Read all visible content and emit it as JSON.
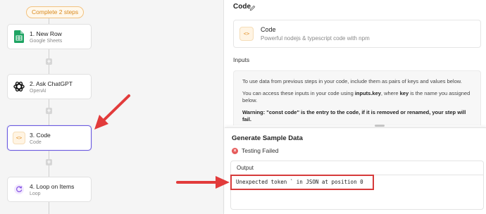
{
  "flow": {
    "progress_label": "Complete 2 steps",
    "steps": [
      {
        "title": "1. New Row",
        "subtitle": "Google Sheets"
      },
      {
        "title": "2. Ask ChatGPT",
        "subtitle": "OpenAI"
      },
      {
        "title": "3. Code",
        "subtitle": "Code"
      },
      {
        "title": "4. Loop on Items",
        "subtitle": "Loop"
      }
    ]
  },
  "panel": {
    "title": "Code",
    "piece": {
      "name": "Code",
      "description": "Powerful nodejs & typescript code with npm"
    },
    "inputs_label": "Inputs",
    "info": {
      "p1": "To use data from previous steps in your code, include them as pairs of keys and values below.",
      "p2_a": "You can access these inputs in your code using ",
      "p2_key": "inputs.key",
      "p2_b": ", where ",
      "p2_key2": "key",
      "p2_c": " is the name you assigned below.",
      "warning": "Warning: \"const code\" is the entry to the code, if it is removed or renamed, your step will fail."
    }
  },
  "sample": {
    "title": "Generate Sample Data",
    "status": "Testing Failed",
    "output_label": "Output",
    "error_text": "Unexpected token ` in JSON at position 0"
  },
  "colors": {
    "accent": "#6a5ae0",
    "error": "#d63a3a",
    "annotation": "#e23b3b",
    "progress": "#d98a1f"
  }
}
